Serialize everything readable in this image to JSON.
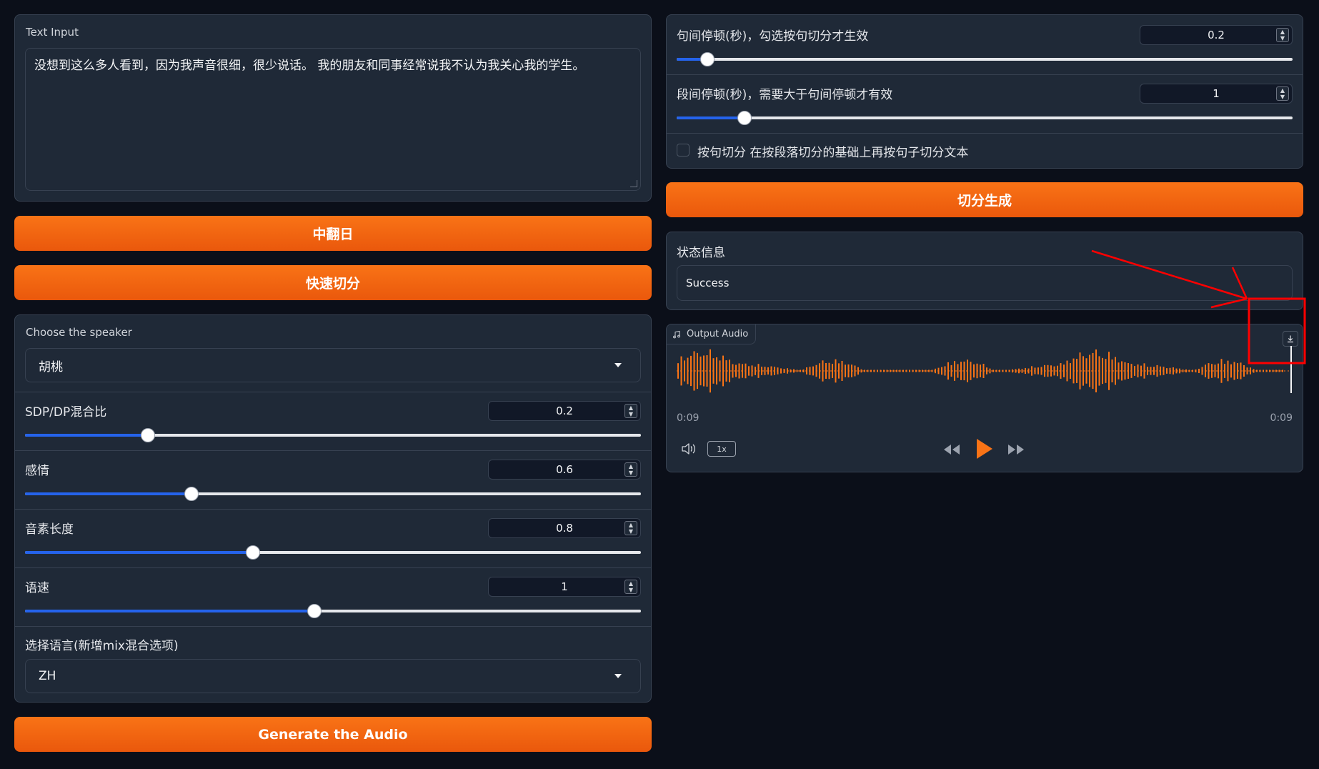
{
  "left": {
    "text_input": {
      "label": "Text Input",
      "value": "没想到这么多人看到，因为我声音很细，很少说话。 我的朋友和同事经常说我不认为我关心我的学生。"
    },
    "translate_button": "中翻日",
    "quick_split_button": "快速切分",
    "speaker": {
      "label": "Choose the speaker",
      "value": "胡桃"
    },
    "sliders": [
      {
        "label": "SDP/DP混合比",
        "value": "0.2",
        "fraction": 0.2
      },
      {
        "label": "感情",
        "value": "0.6",
        "fraction": 0.27
      },
      {
        "label": "音素长度",
        "value": "0.8",
        "fraction": 0.37
      },
      {
        "label": "语速",
        "value": "1",
        "fraction": 0.47
      }
    ],
    "language": {
      "label": "选择语言(新增mix混合选项)",
      "value": "ZH"
    },
    "generate_button": "Generate the Audio"
  },
  "right": {
    "sliders": [
      {
        "label": "句间停顿(秒)，勾选按句切分才生效",
        "value": "0.2",
        "fraction": 0.05
      },
      {
        "label": "段间停顿(秒)，需要大于句间停顿才有效",
        "value": "1",
        "fraction": 0.11
      }
    ],
    "sentence_split_checkbox": {
      "label": "按句切分 在按段落切分的基础上再按句子切分文本",
      "checked": false
    },
    "split_generate_button": "切分生成",
    "status": {
      "label": "状态信息",
      "value": "Success"
    },
    "audio": {
      "label": "Output Audio",
      "time_current": "0:09",
      "time_total": "0:09",
      "speed": "1x",
      "waveform_color": "#f97316",
      "icons": [
        "music-icon",
        "download-icon",
        "volume-icon",
        "rewind-icon",
        "play-icon",
        "forward-icon"
      ]
    }
  },
  "annotation": {
    "color": "#ff0000"
  },
  "colors": {
    "background": "#0b0f19",
    "panel": "#1f2937",
    "accent": "#f97316",
    "slider_fill": "#2563eb"
  }
}
